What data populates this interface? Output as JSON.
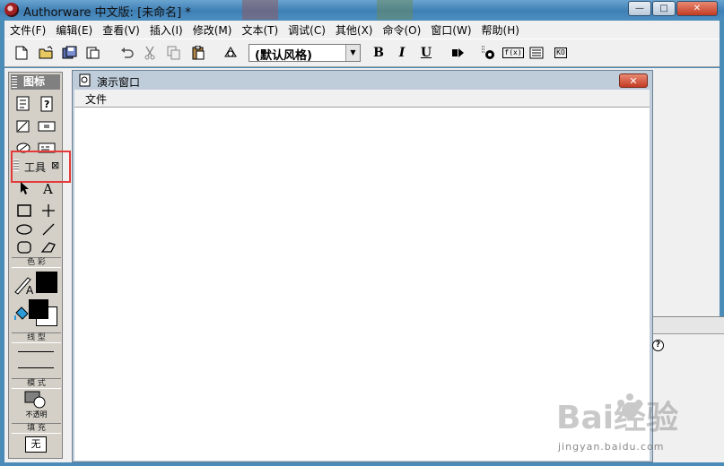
{
  "window": {
    "title": "Authorware 中文版: [未命名] *",
    "controls": {
      "minimize": "—",
      "maximize": "□",
      "close": "✕"
    }
  },
  "menubar": {
    "items": [
      "文件(F)",
      "编辑(E)",
      "查看(V)",
      "插入(I)",
      "修改(M)",
      "文本(T)",
      "调试(C)",
      "其他(X)",
      "命令(O)",
      "窗口(W)",
      "帮助(H)"
    ]
  },
  "toolbar": {
    "icons": [
      "new-file-icon",
      "open-file-icon",
      "save-all-icon",
      "import-icon",
      "undo-icon",
      "cut-icon",
      "copy-icon",
      "paste-icon",
      "find-icon",
      "style-icon",
      "bold-icon",
      "italic-icon",
      "underline-icon",
      "run-icon",
      "control-panel-icon",
      "functions-icon",
      "variables-icon",
      "knowledge-objects-icon"
    ],
    "style_combo": "(默认风格)",
    "bold_label": "B",
    "italic_label": "I",
    "underline_label": "U",
    "fn_label": "f(x)",
    "ko_label": "KO"
  },
  "icon_palette": {
    "title": "图标"
  },
  "tools_palette": {
    "title": "工具",
    "close_glyph": "⊠",
    "color_label": "色 彩",
    "line_label": "线 型",
    "mode_label": "模 式",
    "mode_value": "不透明",
    "fill_label": "填 充",
    "fill_value": "无"
  },
  "presentation": {
    "title": "演示窗口",
    "close": "✕",
    "menu_item": "文件"
  },
  "side_panel": {
    "help": "?"
  },
  "watermark": {
    "text": "jingyan.baidu.com",
    "brand": "Bai经验"
  },
  "colors": {
    "highlight": "#e53a3a",
    "desktop": "#4a8bb8",
    "panel": "#d4d0c8"
  }
}
